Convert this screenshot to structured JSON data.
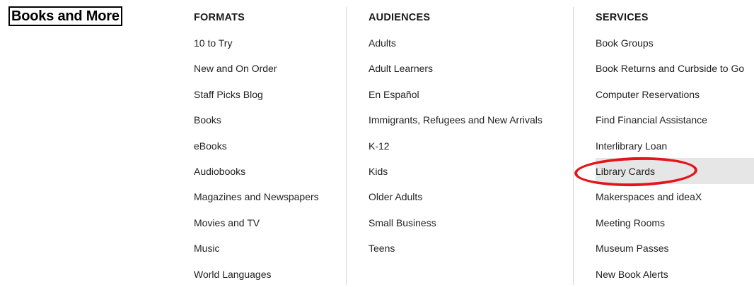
{
  "menu": {
    "title": "Books and More"
  },
  "columns": {
    "formats": {
      "heading": "FORMATS",
      "items": [
        {
          "label": "10 to Try"
        },
        {
          "label": "New and On Order"
        },
        {
          "label": "Staff Picks Blog"
        },
        {
          "label": "Books"
        },
        {
          "label": "eBooks"
        },
        {
          "label": "Audiobooks"
        },
        {
          "label": "Magazines and Newspapers"
        },
        {
          "label": "Movies and TV"
        },
        {
          "label": "Music"
        },
        {
          "label": "World Languages"
        }
      ]
    },
    "audiences": {
      "heading": "AUDIENCES",
      "items": [
        {
          "label": "Adults"
        },
        {
          "label": "Adult Learners"
        },
        {
          "label": "En Español"
        },
        {
          "label": "Immigrants, Refugees and New Arrivals"
        },
        {
          "label": "K-12"
        },
        {
          "label": "Kids"
        },
        {
          "label": "Older Adults"
        },
        {
          "label": "Small Business"
        },
        {
          "label": "Teens"
        }
      ]
    },
    "services": {
      "heading": "SERVICES",
      "items": [
        {
          "label": "Book Groups"
        },
        {
          "label": "Book Returns and Curbside to Go"
        },
        {
          "label": "Computer Reservations"
        },
        {
          "label": "Find Financial Assistance"
        },
        {
          "label": "Interlibrary Loan"
        },
        {
          "label": "Library Cards",
          "highlighted": true
        },
        {
          "label": "Makerspaces and ideaX"
        },
        {
          "label": "Meeting Rooms"
        },
        {
          "label": "Museum Passes"
        },
        {
          "label": "New Book Alerts"
        }
      ]
    }
  },
  "colors": {
    "annotation_circle": "#e5141b",
    "hover_background": "#e6e6e6"
  }
}
